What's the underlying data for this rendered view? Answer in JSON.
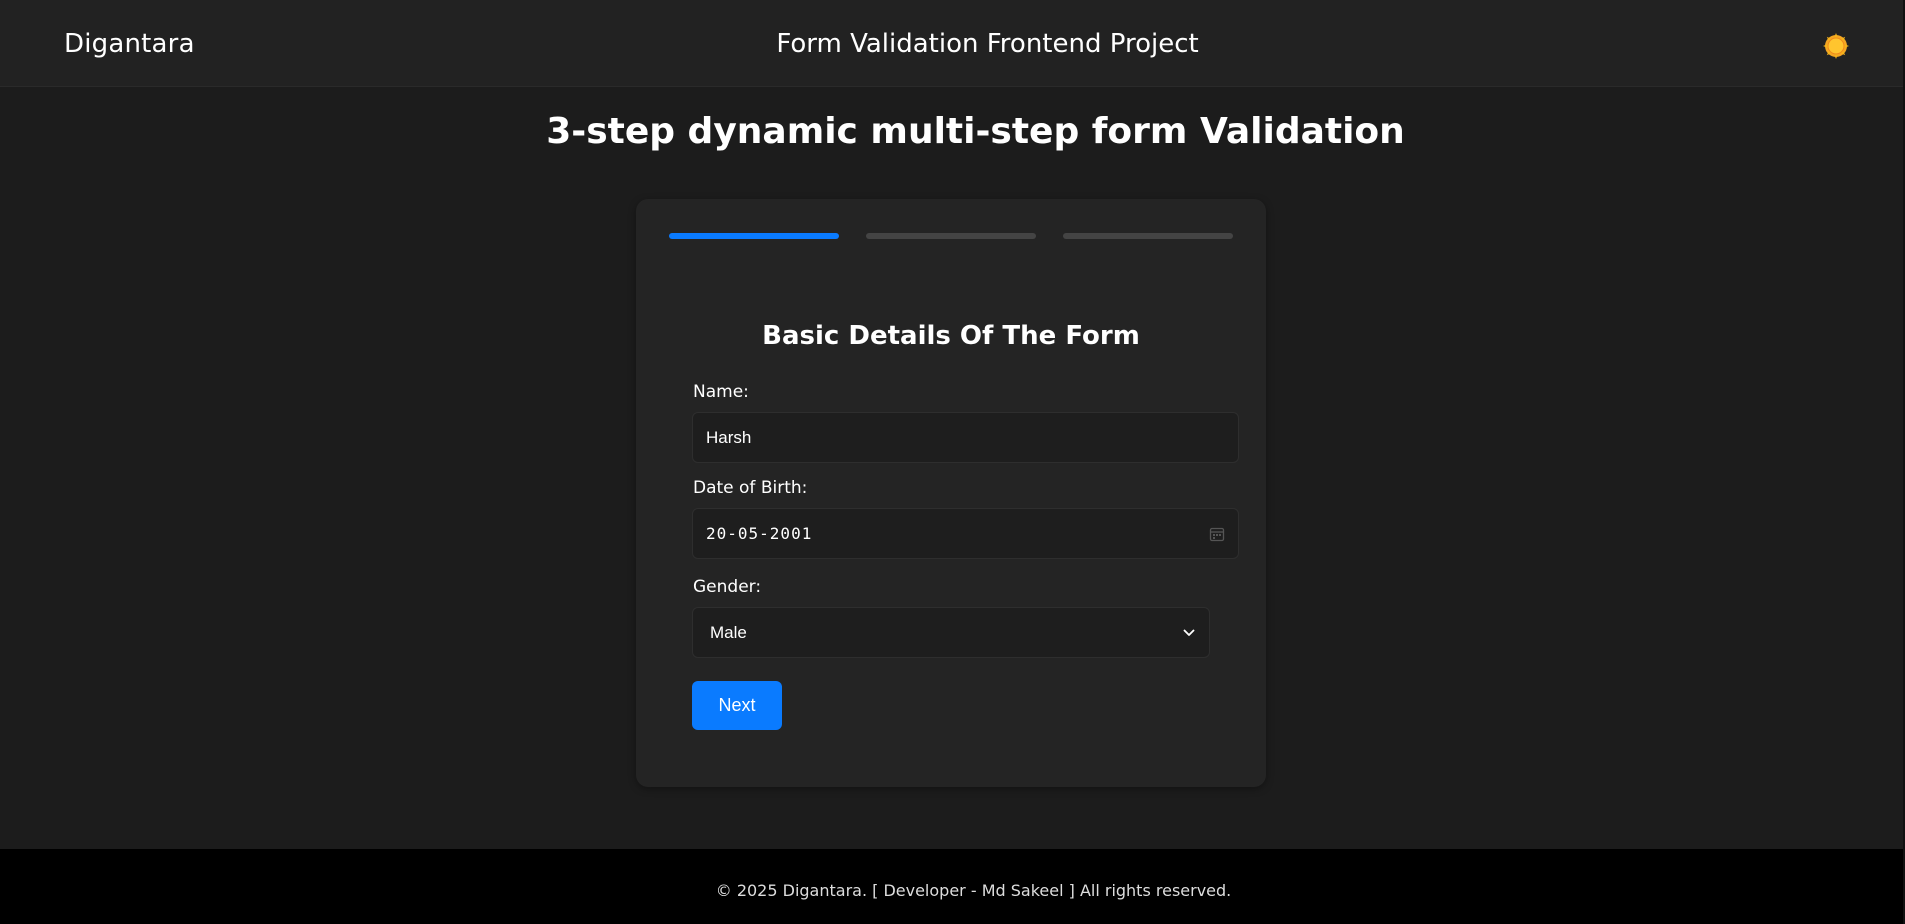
{
  "header": {
    "brand": "Digantara",
    "title": "Form Validation Frontend Project",
    "theme_icon": "sun-icon"
  },
  "main": {
    "heading": "3-step dynamic multi-step form Validation"
  },
  "form": {
    "steps": [
      {
        "label": "step-1",
        "active": true
      },
      {
        "label": "step-2",
        "active": false
      },
      {
        "label": "step-3",
        "active": false
      }
    ],
    "title": "Basic Details Of The Form",
    "name_label": "Name:",
    "name_value": "Harsh",
    "dob_label": "Date of Birth:",
    "dob_value": "20-05-2001",
    "gender_label": "Gender:",
    "gender_value": "Male",
    "next_label": "Next"
  },
  "footer": {
    "text": "© 2025 Digantara. [ Developer - Md Sakeel ] All rights reserved."
  },
  "colors": {
    "accent": "#0a7bff",
    "background": "#1c1c1c",
    "card": "#242424",
    "sun": "#f5b21a"
  }
}
